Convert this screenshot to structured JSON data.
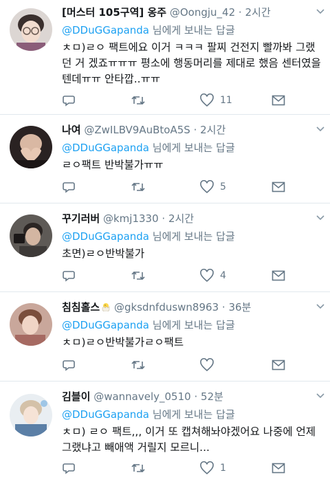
{
  "tweets": [
    {
      "name": "[머스터 105구역] 옹주",
      "handle": "@Oongju_42",
      "time": "2시간",
      "mention": "@DDuGGapanda",
      "reply_suffix": "님에게 보내는 답글",
      "body": "ㅊㅁ)ㄹㅇ 팩트에요 이거 ㅋㅋㅋ 팔찌 건전지 빨까봐 그랬던 거 겠죠ㅠㅠㅠ 평소에 행동머리를 제대로 했음 센터였을텐데ㅠㅠ 안타깝..ㅠㅠ",
      "likes": "11"
    },
    {
      "name": "나여",
      "handle": "@ZwILBV9AuBtoA5S",
      "time": "2시간",
      "mention": "@DDuGGapanda",
      "reply_suffix": "님에게 보내는 답글",
      "body": "ㄹㅇ팩트 반박불가ㅠㅠ",
      "likes": "5"
    },
    {
      "name": "꾸기러버",
      "handle": "@kmj1330",
      "time": "2시간",
      "mention": "@DDuGGapanda",
      "reply_suffix": "님에게 보내는 답글",
      "body": "초면)ㄹㅇ반박불가",
      "likes": "4"
    },
    {
      "name": "침침홀스",
      "handle": "@gksdnfduswn8963",
      "time": "36분",
      "mention": "@DDuGGapanda",
      "reply_suffix": "님에게 보내는 답글",
      "body": "ㅊㅁ)ㄹㅇ반박불가ㄹㅇ팩트",
      "likes": ""
    },
    {
      "name": "김블이",
      "handle": "@wannavely_0510",
      "time": "52분",
      "mention": "@DDuGGapanda",
      "reply_suffix": "님에게 보내는 답글",
      "body": "ㅊㅁ) ㄹㅇ 팩트,,, 이거 또 캡쳐해놔야겠어요 나중에 언제 그랬냐고 빼애액 거릴지 모르니...",
      "likes": "1"
    }
  ],
  "colors": {
    "mention": "#1da1f2",
    "muted": "#657786",
    "divider": "#e1e8ed"
  },
  "icons": {
    "reply": "reply-icon",
    "retweet": "retweet-icon",
    "like": "heart-icon",
    "dm": "mail-icon",
    "menu": "chevron-down-icon"
  }
}
